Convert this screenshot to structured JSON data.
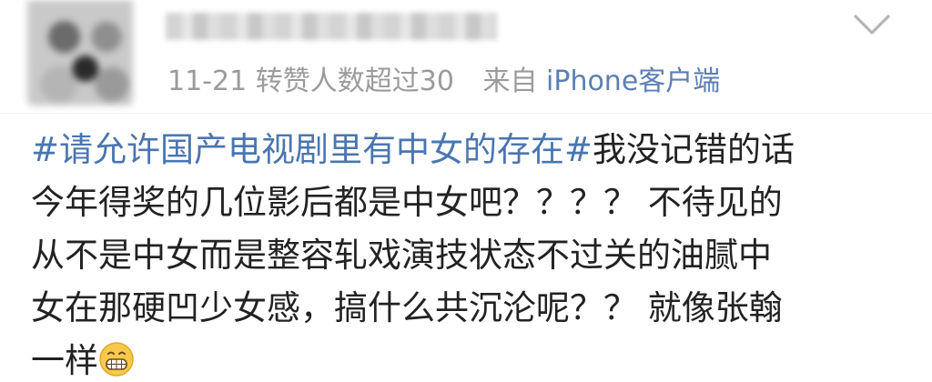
{
  "post": {
    "avatar": {
      "icon": "user-avatar-blurred"
    },
    "username": "",
    "meta": {
      "date": "11-21",
      "reposts_note": "转赞人数超过30",
      "from_label": "来自",
      "client": "iPhone客户端"
    },
    "topic": "#请允许国产电视剧里有中女的存在#",
    "lines": [
      "我没记错的话",
      "今年得奖的几位影后都是中女吧？？？？ 不待见的",
      "从不是中女而是整容轧戏演技状态不过关的油腻中",
      "女在那硬凹少女感，搞什么共沉沦呢？？ 就像张翰",
      "一样"
    ],
    "emoji": "grin-emoji",
    "menu_icon": "chevron-down-icon"
  },
  "colors": {
    "topic_link": "#4a76b0",
    "client_link": "#5b7fb2",
    "meta_text": "#9b9b9b",
    "body_text": "#222222"
  }
}
